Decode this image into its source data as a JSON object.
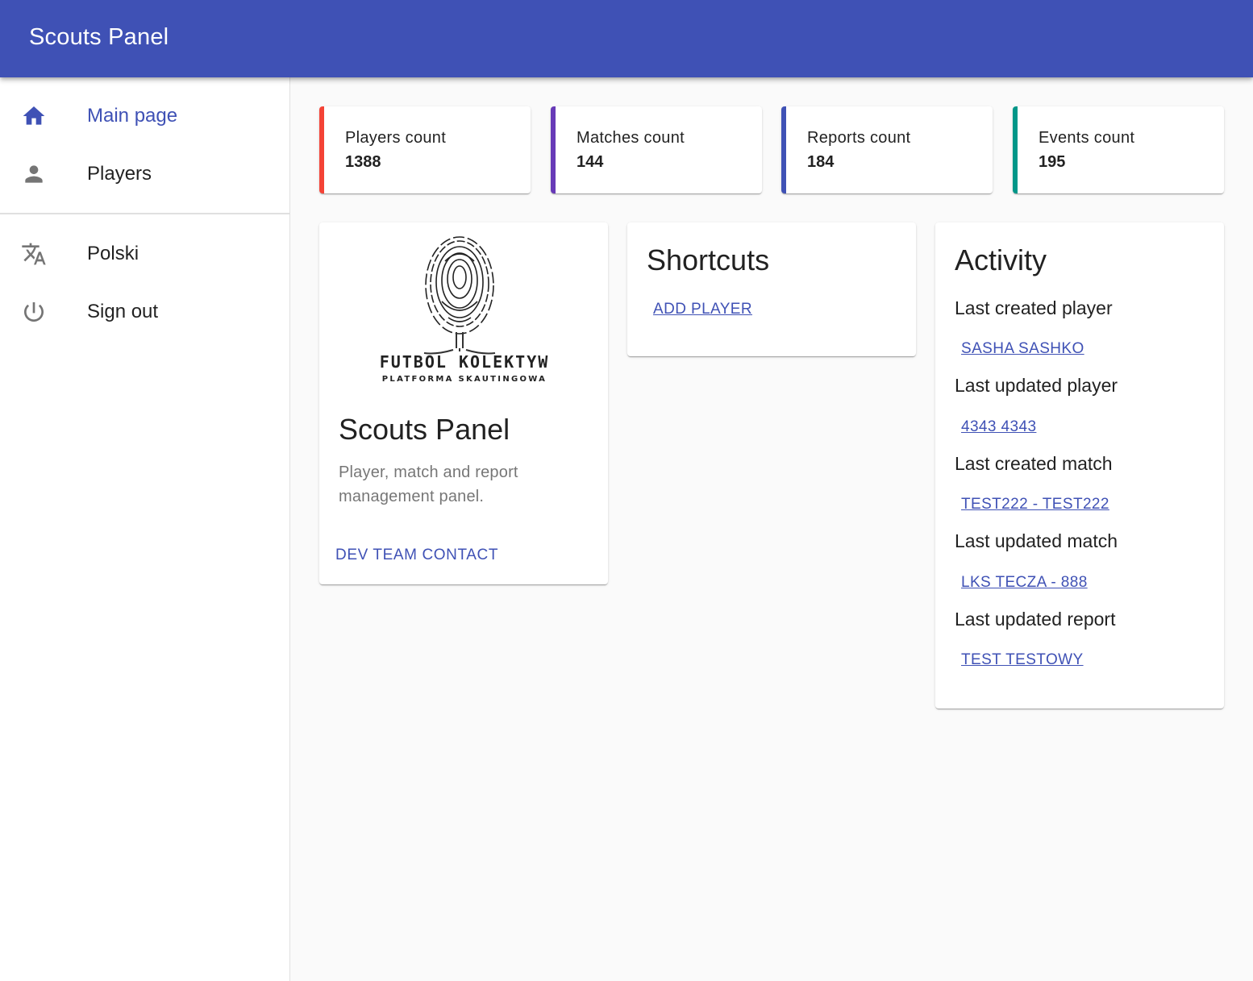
{
  "app": {
    "title": "Scouts Panel"
  },
  "sidebar": {
    "items": [
      {
        "label": "Main page",
        "icon": "home-icon",
        "active": true
      },
      {
        "label": "Players",
        "icon": "person-icon",
        "active": false
      },
      {
        "label": "Polski",
        "icon": "translate-icon",
        "active": false
      },
      {
        "label": "Sign out",
        "icon": "power-icon",
        "active": false
      }
    ]
  },
  "stats": [
    {
      "label": "Players count",
      "value": "1388",
      "color": "#f44336"
    },
    {
      "label": "Matches count",
      "value": "144",
      "color": "#673ab7"
    },
    {
      "label": "Reports count",
      "value": "184",
      "color": "#3f51b5"
    },
    {
      "label": "Events count",
      "value": "195",
      "color": "#009688"
    }
  ],
  "about": {
    "logo_text": "FUTBOL KOLEKTYW",
    "logo_subtext": "PLATFORMA SKAUTINGOWA",
    "title": "Scouts Panel",
    "description": "Player, match and report management panel.",
    "action": "DEV TEAM CONTACT"
  },
  "shortcuts": {
    "title": "Shortcuts",
    "add_player": "ADD PLAYER"
  },
  "activity": {
    "title": "Activity",
    "items": [
      {
        "label": "Last created player",
        "link": "SASHA SASHKO"
      },
      {
        "label": "Last updated player",
        "link": "4343 4343"
      },
      {
        "label": "Last created match",
        "link": "TEST222 - TEST222"
      },
      {
        "label": "Last updated match",
        "link": "LKS TECZA - 888"
      },
      {
        "label": "Last updated report",
        "link": "TEST TESTOWY"
      }
    ]
  },
  "colors": {
    "primary": "#3f51b5",
    "icon_grey": "#757575"
  }
}
